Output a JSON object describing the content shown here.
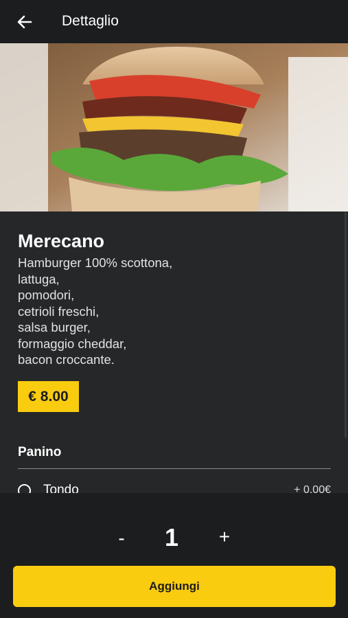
{
  "header": {
    "title": "Dettaglio",
    "back_icon": "arrow-left-icon"
  },
  "product": {
    "name": "Merecano",
    "description": "Hamburger 100% scottona,\nlattuga,\npomodori,\ncetrioli freschi,\nsalsa burger,\nformaggio cheddar,\nbacon croccante.",
    "price": "€ 8.00",
    "image_alt": "Burger"
  },
  "options": {
    "section_title": "Panino",
    "items": [
      {
        "label": "Tondo",
        "price": "+ 0.00€",
        "selected": false
      }
    ]
  },
  "cart": {
    "minus_label": "-",
    "quantity": "1",
    "plus_label": "+",
    "add_label": "Aggiungi"
  },
  "colors": {
    "accent": "#f9cc0f",
    "background": "#262729",
    "bar": "#1c1d1f"
  }
}
